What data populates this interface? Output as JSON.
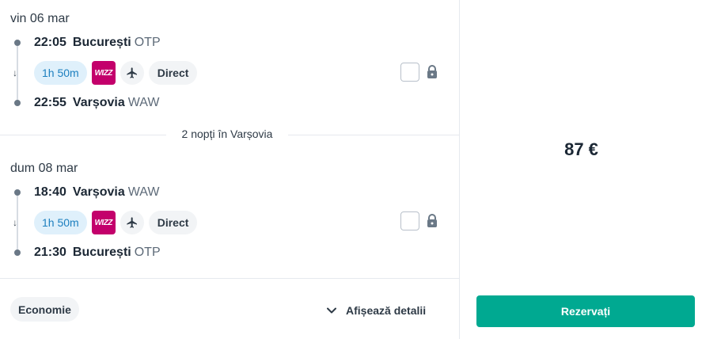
{
  "outbound": {
    "date": "vin 06 mar",
    "departure": {
      "time": "22:05",
      "city": "București",
      "code": "OTP"
    },
    "arrival": {
      "time": "22:55",
      "city": "Varșovia",
      "code": "WAW"
    },
    "duration": "1h 50m",
    "airline_logo_text": "WIZZ",
    "stops_label": "Direct"
  },
  "stay_label": "2 nopți în Varșovia",
  "inbound": {
    "date": "dum 08 mar",
    "departure": {
      "time": "18:40",
      "city": "Varșovia",
      "code": "WAW"
    },
    "arrival": {
      "time": "21:30",
      "city": "București",
      "code": "OTP"
    },
    "duration": "1h 50m",
    "airline_logo_text": "WIZZ",
    "stops_label": "Direct"
  },
  "footer": {
    "cabin_class": "Economie",
    "details_label": "Afișează detalii"
  },
  "booking": {
    "price": "87 €",
    "book_label": "Rezervați"
  },
  "icons": {
    "airline": "wizz-air-logo-icon",
    "plane": "plane-icon",
    "lock": "lock-icon",
    "chevron": "chevron-down-icon",
    "arrow": "arrow-down-icon"
  },
  "colors": {
    "accent": "#00a991",
    "duration_bg": "#dff0fb",
    "duration_text": "#1c7fbf",
    "airline_brand": "#c3006b"
  }
}
